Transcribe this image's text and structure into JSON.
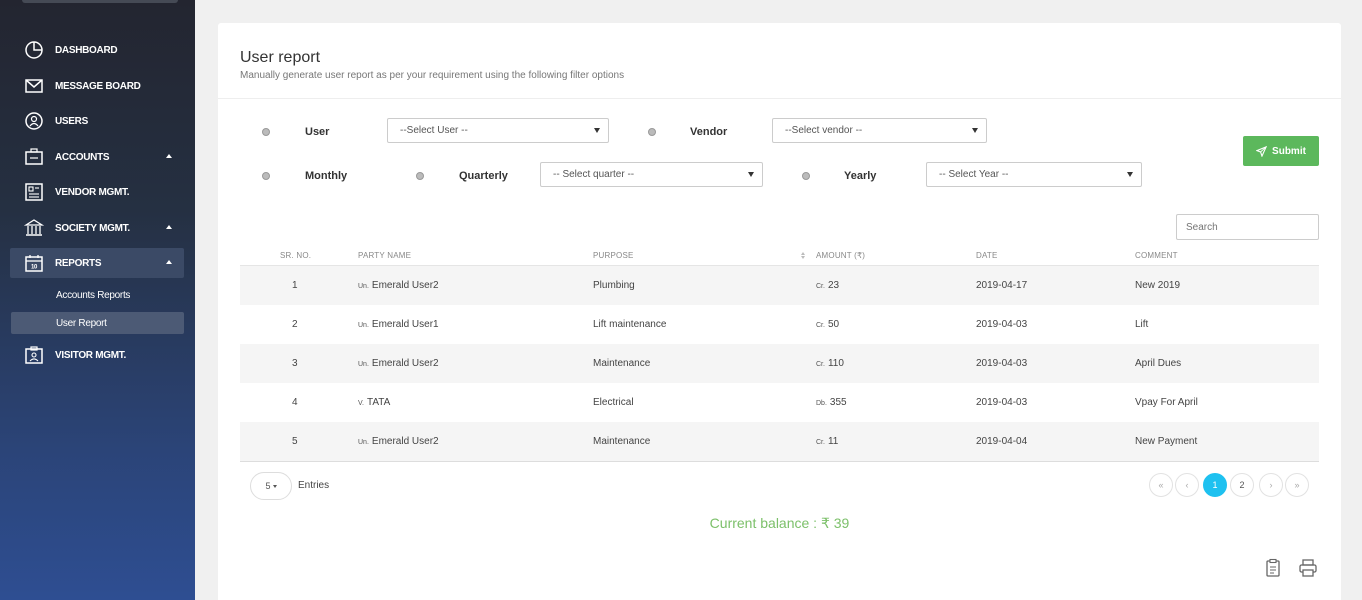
{
  "sidebar": {
    "items": [
      {
        "label": "DASHBOARD",
        "icon": "dashboard-icon"
      },
      {
        "label": "MESSAGE BOARD",
        "icon": "envelope-icon"
      },
      {
        "label": "USERS",
        "icon": "users-icon"
      },
      {
        "label": "ACCOUNTS",
        "icon": "accounts-icon"
      },
      {
        "label": "VENDOR MGMT.",
        "icon": "vendor-icon"
      },
      {
        "label": "SOCIETY MGMT.",
        "icon": "building-icon"
      },
      {
        "label": "REPORTS",
        "icon": "calendar-icon"
      },
      {
        "label": "VISITOR MGMT.",
        "icon": "visitor-icon"
      }
    ],
    "reports_sub": [
      {
        "label": "Accounts Reports"
      },
      {
        "label": "User Report"
      }
    ]
  },
  "page": {
    "title": "User report",
    "subtitle": "Manually generate user report as per your requirement using the following filter options"
  },
  "filters": {
    "user_label": "User",
    "user_placeholder": "--Select User --",
    "vendor_label": "Vendor",
    "vendor_placeholder": "--Select vendor --",
    "monthly_label": "Monthly",
    "quarterly_label": "Quarterly",
    "quarter_placeholder": "-- Select quarter --",
    "yearly_label": "Yearly",
    "year_placeholder": "-- Select Year --",
    "submit_label": "Submit"
  },
  "search": {
    "placeholder": "Search"
  },
  "table": {
    "headers": {
      "sr": "SR. NO.",
      "party": "PARTY NAME",
      "purpose": "PURPOSE",
      "amount": "AMOUNT (₹)",
      "date": "DATE",
      "comment": "COMMENT"
    },
    "rows": [
      {
        "sr": "1",
        "party_prefix": "Un.",
        "party": "Emerald User2",
        "purpose": "Plumbing",
        "amount_prefix": "Cr.",
        "amount": "23",
        "date": "2019-04-17",
        "comment": "New 2019"
      },
      {
        "sr": "2",
        "party_prefix": "Un.",
        "party": "Emerald User1",
        "purpose": "Lift maintenance",
        "amount_prefix": "Cr.",
        "amount": "50",
        "date": "2019-04-03",
        "comment": "Lift"
      },
      {
        "sr": "3",
        "party_prefix": "Un.",
        "party": "Emerald User2",
        "purpose": "Maintenance",
        "amount_prefix": "Cr.",
        "amount": "110",
        "date": "2019-04-03",
        "comment": "April Dues"
      },
      {
        "sr": "4",
        "party_prefix": "V.",
        "party": "TATA",
        "purpose": "Electrical",
        "amount_prefix": "Db.",
        "amount": "355",
        "date": "2019-04-03",
        "comment": "Vpay For April"
      },
      {
        "sr": "5",
        "party_prefix": "Un.",
        "party": "Emerald User2",
        "purpose": "Maintenance",
        "amount_prefix": "Cr.",
        "amount": "11",
        "date": "2019-04-04",
        "comment": "New Payment"
      }
    ]
  },
  "pagination": {
    "entries_value": "5",
    "entries_label": "Entries",
    "first": "«",
    "prev": "‹",
    "page1": "1",
    "page2": "2",
    "next": "›",
    "last": "»"
  },
  "balance": {
    "text": "Current balance : ₹ 39"
  },
  "colors": {
    "accent_green": "#5cb85c",
    "active_page": "#1ec1f0",
    "balance_green": "#7cc06a"
  }
}
